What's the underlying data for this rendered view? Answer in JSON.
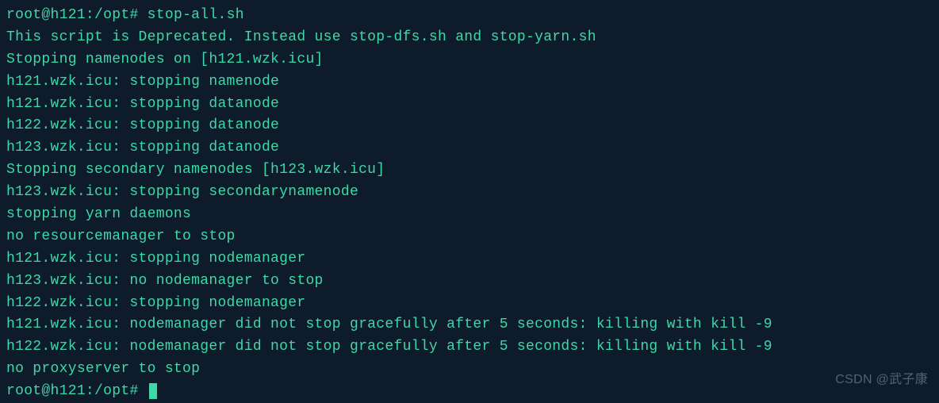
{
  "prompt1": {
    "user_host": "root@h121",
    "path": "/opt",
    "sep": "#",
    "command": "stop-all.sh"
  },
  "output": [
    "This script is Deprecated. Instead use stop-dfs.sh and stop-yarn.sh",
    "Stopping namenodes on [h121.wzk.icu]",
    "h121.wzk.icu: stopping namenode",
    "h121.wzk.icu: stopping datanode",
    "h122.wzk.icu: stopping datanode",
    "h123.wzk.icu: stopping datanode",
    "Stopping secondary namenodes [h123.wzk.icu]",
    "h123.wzk.icu: stopping secondarynamenode",
    "stopping yarn daemons",
    "no resourcemanager to stop",
    "h121.wzk.icu: stopping nodemanager",
    "h123.wzk.icu: no nodemanager to stop",
    "h122.wzk.icu: stopping nodemanager",
    "h121.wzk.icu: nodemanager did not stop gracefully after 5 seconds: killing with kill -9",
    "h122.wzk.icu: nodemanager did not stop gracefully after 5 seconds: killing with kill -9",
    "no proxyserver to stop"
  ],
  "prompt2": {
    "user_host": "root@h121",
    "path": "/opt",
    "sep": "#",
    "command": ""
  },
  "watermark": "CSDN @武子康"
}
